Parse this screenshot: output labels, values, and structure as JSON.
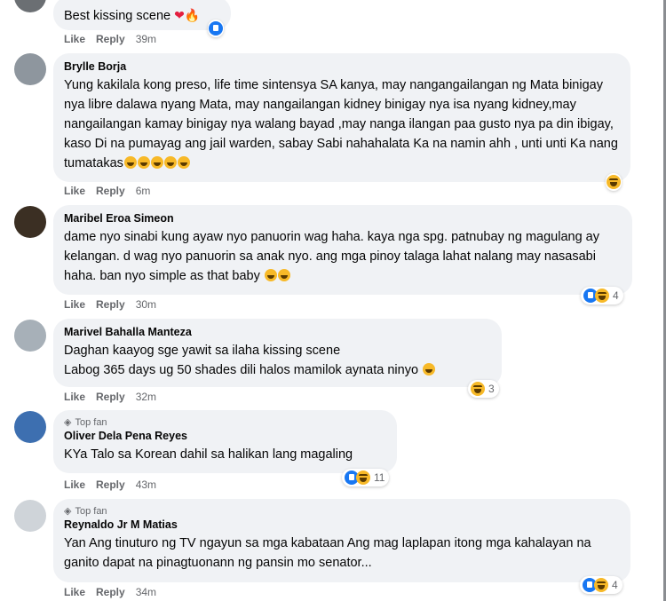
{
  "comments": [
    {
      "name": "",
      "top_fan": "",
      "text": "Best kissing scene",
      "emoji_trail": [
        "heart",
        "fire"
      ],
      "like": "Like",
      "reply": "Reply",
      "time": "39m",
      "reactions": {
        "icons": [
          "like"
        ],
        "count": ""
      }
    },
    {
      "name": "Brylle Borja",
      "top_fan": "",
      "text": "Yung kakilala kong preso, life time sintensya SA kanya, may nangangailangan ng Mata binigay nya libre dalawa nyang Mata, may nangailangan kidney binigay nya isa nyang kidney,may nangailangan kamay binigay nya walang bayad ,may nanga ilangan paa gusto nya pa din ibigay, kaso Di na pumayag ang jail warden, sabay Sabi nahahalata Ka na namin ahh , unti unti Ka nang tumatakas",
      "emoji_trail": [
        "rofl",
        "rofl",
        "rofl",
        "joy",
        "joy"
      ],
      "like": "Like",
      "reply": "Reply",
      "time": "6m",
      "reactions": {
        "icons": [
          "haha"
        ],
        "count": ""
      }
    },
    {
      "name": "Maribel Eroa Simeon",
      "top_fan": "",
      "text": "dame nyo sinabi kung ayaw nyo panuorin wag haha. kaya nga spg. patnubay ng magulang ay kelangan. d wag nyo panuorin sa anak nyo. ang mga pinoy talaga lahat nalang may nasasabi haha. ban nyo simple as that baby",
      "emoji_trail": [
        "joy",
        "grin"
      ],
      "like": "Like",
      "reply": "Reply",
      "time": "30m",
      "reactions": {
        "icons": [
          "like",
          "haha"
        ],
        "count": "4"
      }
    },
    {
      "name": "Marivel Bahalla Manteza",
      "top_fan": "",
      "text": "Daghan kaayog sge yawit sa ilaha kissing scene\nLabog 365 days ug 50 shades dili halos mamilok aynata ninyo",
      "emoji_trail": [
        "rofl"
      ],
      "like": "Like",
      "reply": "Reply",
      "time": "32m",
      "reactions": {
        "icons": [
          "haha"
        ],
        "count": "3"
      }
    },
    {
      "name": "Oliver Dela Pena Reyes",
      "top_fan": "Top fan",
      "text": "KYa Talo sa Korean dahil sa halikan lang magaling",
      "emoji_trail": [],
      "like": "Like",
      "reply": "Reply",
      "time": "43m",
      "reactions": {
        "icons": [
          "like",
          "haha"
        ],
        "count": "11"
      }
    },
    {
      "name": "Reynaldo Jr M Matias",
      "top_fan": "Top fan",
      "text": "Yan Ang tinuturo ng TV ngayun sa mga kabataan Ang mag laplapan itong mga kahalayan na ganito dapat na pinagtuonann ng pansin mo senator...",
      "emoji_trail": [],
      "like": "Like",
      "reply": "Reply",
      "time": "34m",
      "reactions": {
        "icons": [
          "like",
          "haha"
        ],
        "count": "4"
      }
    }
  ]
}
